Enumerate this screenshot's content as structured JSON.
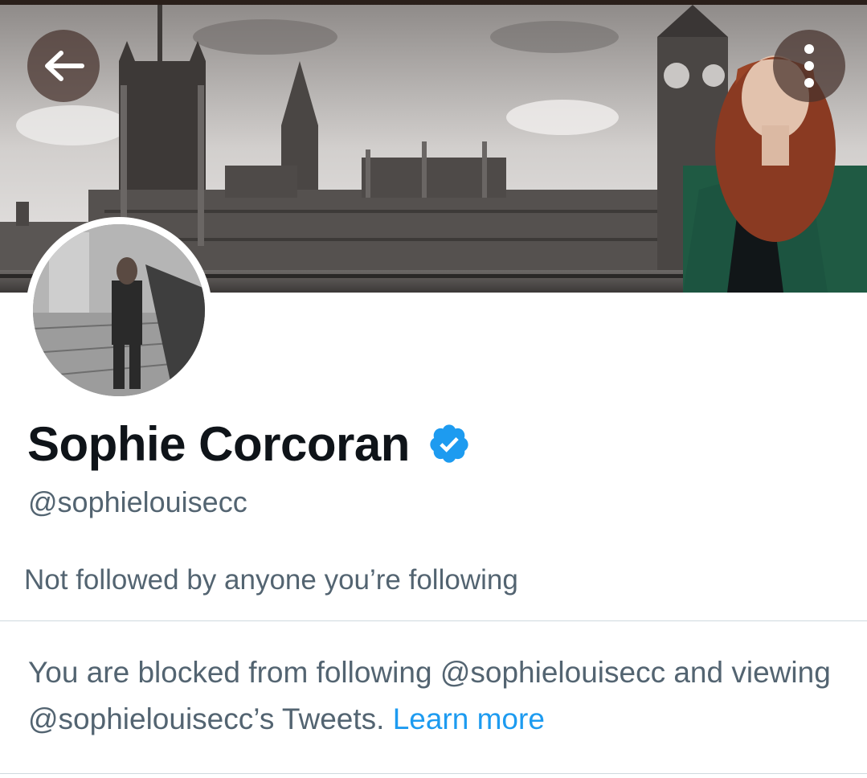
{
  "header": {
    "back_icon": "arrow-left-icon",
    "more_icon": "more-vertical-icon"
  },
  "profile": {
    "display_name": "Sophie Corcoran",
    "verified": true,
    "verified_icon": "verified-badge-icon",
    "handle": "@sophielouisecc",
    "followers_you_know": "Not followed by anyone you’re following"
  },
  "blocked_notice": {
    "text": "You are blocked from following @sophielouisecc and viewing @sophielouisecc’s Tweets. ",
    "link_label": "Learn more"
  },
  "colors": {
    "accent": "#1d9bf0",
    "primary_text": "#0f1419",
    "secondary_text": "#536471",
    "divider": "#cfd9de"
  }
}
